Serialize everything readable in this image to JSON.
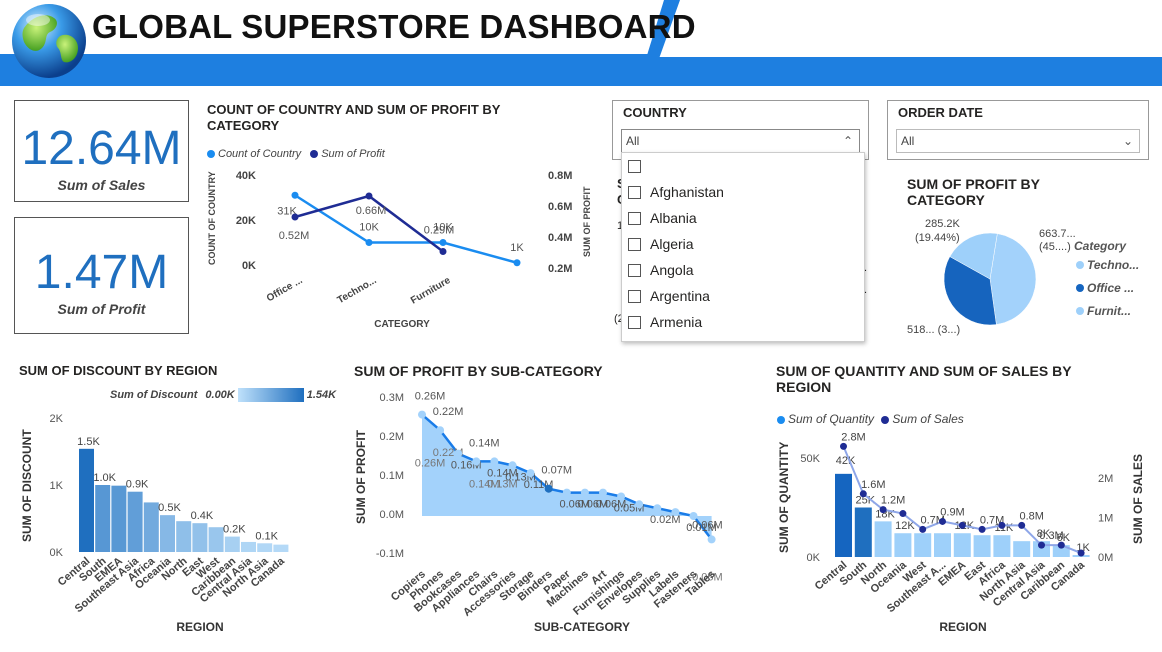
{
  "header": {
    "title": "GLOBAL SUPERSTORE DASHBOARD"
  },
  "kpis": [
    {
      "value": "12.64M",
      "label": "Sum of Sales"
    },
    {
      "value": "1.47M",
      "label": "Sum of Profit"
    }
  ],
  "colors": {
    "accent": "#1a7ce8",
    "dark": "#1f2c94",
    "mid": "#1f6fbf",
    "light": "#9ed0fa",
    "header_blue": "#1e7fe0"
  },
  "country_slicer": {
    "title": "COUNTRY",
    "selected": "All",
    "options": [
      "",
      "Afghanistan",
      "Albania",
      "Algeria",
      "Angola",
      "Argentina",
      "Armenia"
    ]
  },
  "date_slicer": {
    "title": "ORDER DATE",
    "selected": "All"
  },
  "obscured_fragments": {
    "a": "S",
    "b": "C",
    "c": "1",
    "d": "(2"
  },
  "chart_data": [
    {
      "id": "country_profit_by_category",
      "type": "line",
      "title": "COUNT OF COUNTRY AND SUM OF PROFIT BY CATEGORY",
      "xlabel": "CATEGORY",
      "ylabel": "COUNT OF COUNTRY",
      "y2label": "SUM OF PROFIT",
      "categories": [
        "Office ...",
        "Techno...",
        "Furniture",
        ""
      ],
      "y_ticks": [
        "40K",
        "20K",
        "0K"
      ],
      "y2_ticks": [
        "0.8M",
        "0.6M",
        "0.4M",
        "0.2M"
      ],
      "series": [
        {
          "name": "Count of Country",
          "values": [
            31,
            10,
            10,
            1
          ],
          "labels": [
            "31K",
            "10K",
            "10K",
            "1K"
          ]
        },
        {
          "name": "Sum of Profit",
          "values": [
            0.52,
            0.66,
            0.29
          ],
          "labels": [
            "0.52M",
            "0.66M",
            "0.29M"
          ]
        }
      ]
    },
    {
      "id": "profit_by_category_pie",
      "type": "pie",
      "title": "SUM OF PROFIT BY CATEGORY",
      "legend_title": "Category",
      "categories": [
        "Techno...",
        "Office ...",
        "Furnit..."
      ],
      "values": [
        663.7,
        518,
        285.2
      ],
      "labels": [
        "663.7... (45....)",
        "518... (3...)",
        "285.2K (19.44%)"
      ]
    },
    {
      "id": "discount_by_region",
      "type": "bar",
      "title": "SUM OF DISCOUNT BY REGION",
      "xlabel": "REGION",
      "ylabel": "SUM OF DISCOUNT",
      "legend_label": "Sum of Discount",
      "legend_min": "0.00K",
      "legend_max": "1.54K",
      "y_ticks": [
        "2K",
        "1K",
        "0K"
      ],
      "categories": [
        "Central",
        "South",
        "EMEA",
        "Southeast Asia",
        "Africa",
        "Oceania",
        "North",
        "East",
        "West",
        "Caribbean",
        "Central Asia",
        "North Asia",
        "Canada"
      ],
      "values": [
        1.54,
        1.0,
        0.99,
        0.9,
        0.74,
        0.55,
        0.46,
        0.43,
        0.37,
        0.23,
        0.15,
        0.13,
        0.11
      ],
      "labels": [
        "1.5K",
        "1.0K",
        "",
        "0.9K",
        "",
        "0.5K",
        "",
        "0.4K",
        "",
        "0.2K",
        "",
        "0.1K",
        ""
      ]
    },
    {
      "id": "profit_by_subcategory",
      "type": "area",
      "title": "SUM OF PROFIT BY SUB-CATEGORY",
      "xlabel": "SUB-CATEGORY",
      "ylabel": "SUM OF PROFIT",
      "y_ticks": [
        "0.3M",
        "0.2M",
        "0.1M",
        "0.0M",
        "-0.1M"
      ],
      "categories": [
        "Copiers",
        "Phones",
        "Bookcases",
        "Appliances",
        "Chairs",
        "Accessories",
        "Storage",
        "Binders",
        "Paper",
        "Machines",
        "Art",
        "Furnishings",
        "Envelopes",
        "Supplies",
        "Labels",
        "Fasteners",
        "Tables"
      ],
      "values": [
        0.26,
        0.22,
        0.16,
        0.14,
        0.14,
        0.13,
        0.11,
        0.07,
        0.06,
        0.06,
        0.06,
        0.05,
        0.03,
        0.02,
        0.01,
        0.0,
        -0.06
      ],
      "labels": [
        "0.26M",
        "0.22M",
        "0.16M",
        "0.14M",
        "0.14M",
        "0.13M",
        "0.11M",
        "0.07M",
        "0.06M",
        "0.06M",
        "0.06M",
        "0.05M",
        "",
        "0.02M",
        "",
        "0.01M",
        "-0.06M"
      ],
      "shadow_labels": [
        "0.26M",
        "0.22M",
        "",
        "0.14M",
        "0.13M",
        "",
        "",
        "",
        "",
        "",
        "",
        "",
        "",
        "",
        "",
        "",
        "-0.06M"
      ]
    },
    {
      "id": "quantity_sales_by_region",
      "type": "bar",
      "title": "SUM OF QUANTITY AND SUM OF SALES BY REGION",
      "xlabel": "REGION",
      "ylabel": "SUM OF QUANTITY",
      "y2label": "SUM OF SALES",
      "y_ticks": [
        "50K",
        "0K"
      ],
      "y2_ticks": [
        "2M",
        "1M",
        "0M"
      ],
      "categories": [
        "Central",
        "South",
        "North",
        "Oceania",
        "West",
        "Southeast A...",
        "EMEA",
        "East",
        "Africa",
        "North Asia",
        "Central Asia",
        "Caribbean",
        "Canada"
      ],
      "series": [
        {
          "name": "Sum of Quantity",
          "values": [
            42,
            25,
            18,
            12,
            12,
            12,
            12,
            11,
            11,
            8,
            8,
            6,
            1
          ],
          "labels": [
            "42K",
            "25K",
            "18K",
            "12K",
            "",
            "",
            "12K",
            "",
            "11K",
            "",
            "8K",
            "6K",
            "1K"
          ]
        },
        {
          "name": "Sum of Sales",
          "values": [
            2.8,
            1.6,
            1.2,
            1.1,
            0.7,
            0.9,
            0.8,
            0.7,
            0.8,
            0.8,
            0.3,
            0.3,
            0.1
          ],
          "labels": [
            "2.8M",
            "1.6M",
            "1.2M",
            "",
            "0.7M",
            "0.9M",
            "",
            "0.7M",
            "",
            "0.8M",
            "0.3M",
            "",
            ""
          ]
        }
      ]
    }
  ]
}
